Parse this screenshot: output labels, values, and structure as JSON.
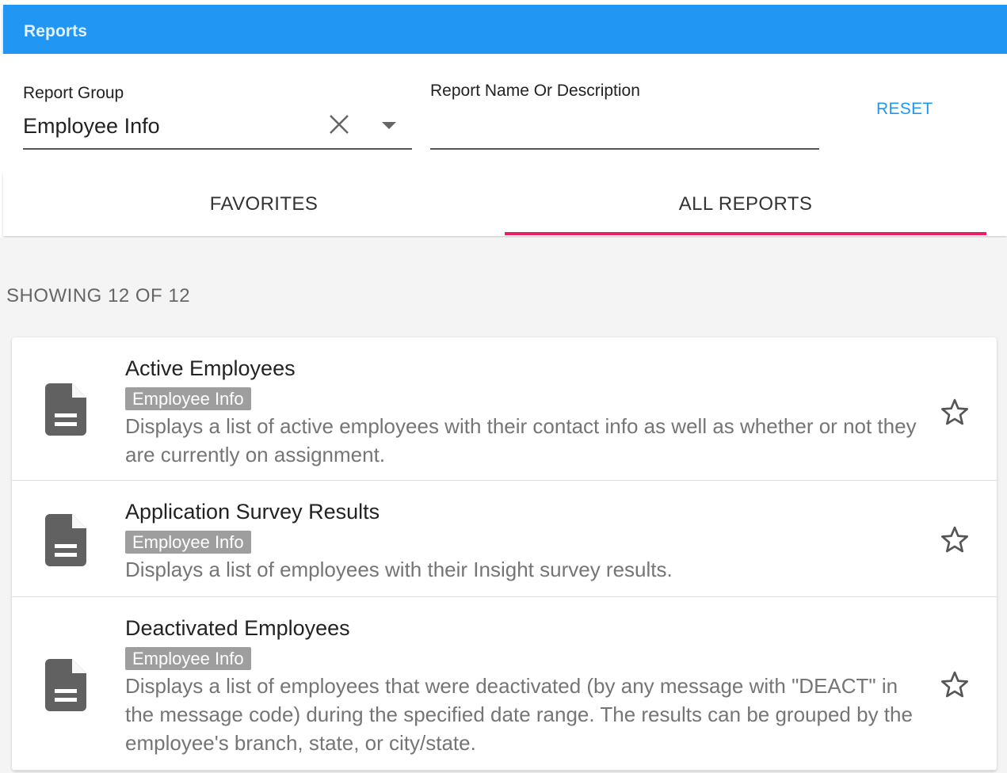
{
  "appbar": {
    "title": "Reports"
  },
  "filters": {
    "group_label": "Report Group",
    "group_value": "Employee Info",
    "search_label": "Report Name Or Description",
    "search_value": "",
    "reset_label": "RESET"
  },
  "tabs": [
    {
      "label": "FAVORITES",
      "active": false
    },
    {
      "label": "ALL REPORTS",
      "active": true
    }
  ],
  "showing": "SHOWING 12 OF 12",
  "reports": [
    {
      "name": "Active Employees",
      "group": "Employee Info",
      "description": "Displays a list of active employees with their contact info as well as whether or not they are currently on assignment.",
      "favorite": false
    },
    {
      "name": "Application Survey Results",
      "group": "Employee Info",
      "description": "Displays a list of employees with their Insight survey results.",
      "favorite": false
    },
    {
      "name": "Deactivated Employees",
      "group": "Employee Info",
      "description": "Displays a list of employees that were deactivated (by any message with \"DEACT\" in the message code) during the specified date range. The results can be grouped by the employee's branch, state, or city/state.",
      "favorite": false
    }
  ],
  "colors": {
    "appbar": "#2196f3",
    "tab_indicator": "#e91e63",
    "accent": "#2196f3",
    "tag_bg": "#9e9e9e"
  },
  "icons": {
    "report": "document-icon",
    "favorite": "star-outline-icon",
    "clear": "close-icon",
    "dropdown": "caret-down-icon"
  }
}
